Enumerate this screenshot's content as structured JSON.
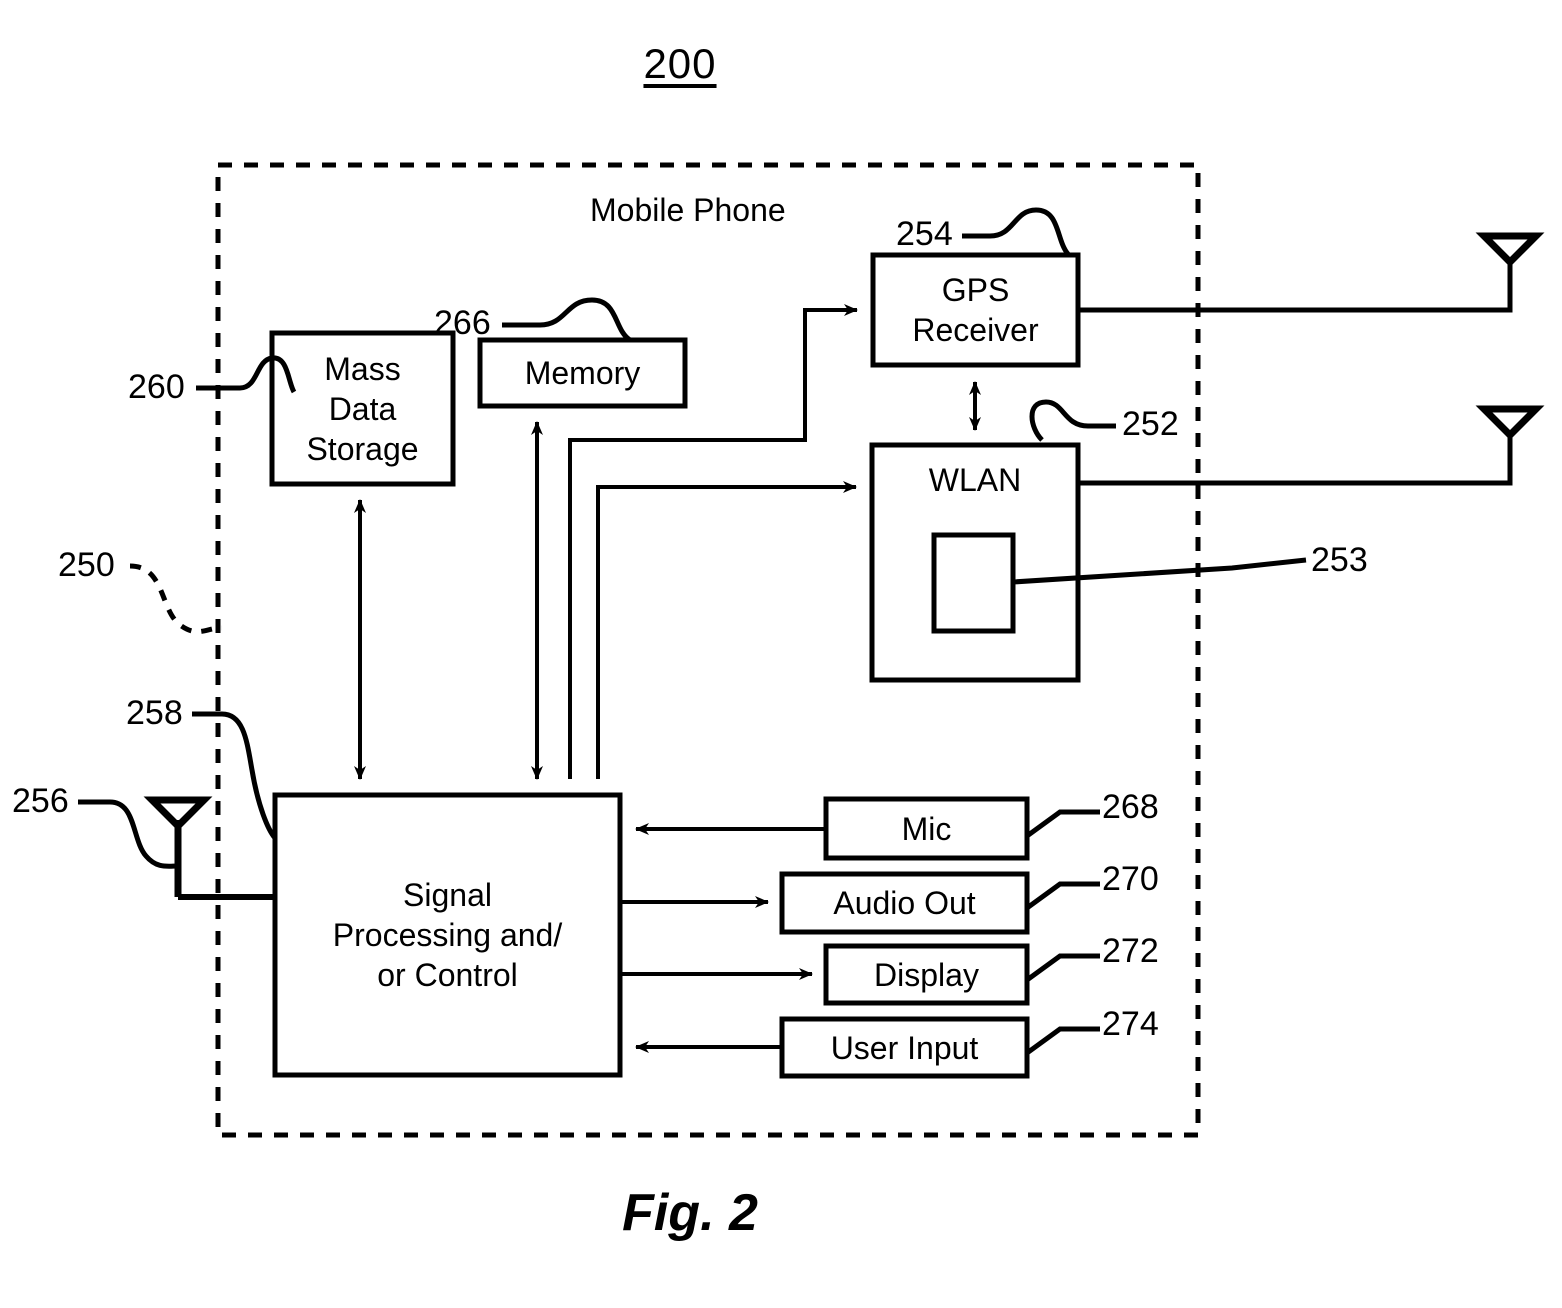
{
  "figure": {
    "number": "200",
    "caption": "Fig. 2",
    "enclosure_label": "Mobile Phone"
  },
  "blocks": {
    "mass_data_storage": {
      "label": "Mass\nData\nStorage",
      "ref": "260"
    },
    "memory": {
      "label": "Memory",
      "ref": "266"
    },
    "gps_receiver": {
      "label": "GPS\nReceiver",
      "ref": "254"
    },
    "wlan": {
      "label": "WLAN",
      "ref": "252"
    },
    "wlan_inner": {
      "label": "",
      "ref": "253"
    },
    "signal_processing": {
      "label": "Signal\nProcessing and/\nor Control",
      "ref": "258"
    },
    "mic": {
      "label": "Mic",
      "ref": "268"
    },
    "audio_out": {
      "label": "Audio Out",
      "ref": "270"
    },
    "display": {
      "label": "Display",
      "ref": "272"
    },
    "user_input": {
      "label": "User Input",
      "ref": "274"
    }
  },
  "refs": {
    "enclosure": "250",
    "cell_antenna": "256",
    "signal_processing": "258",
    "mass_data_storage": "260",
    "memory": "266",
    "gps_receiver": "254",
    "wlan": "252",
    "wlan_inner": "253",
    "mic": "268",
    "audio_out": "270",
    "display": "272",
    "user_input": "274"
  },
  "antennas": {
    "cellular": {
      "ref": "256"
    },
    "gps": {
      "ref": ""
    },
    "wlan": {
      "ref": ""
    }
  },
  "colors": {
    "stroke": "#000000",
    "background": "#ffffff"
  },
  "style": {
    "line_width": 4,
    "box_line_width": 5,
    "dash_pattern": "14 12"
  }
}
